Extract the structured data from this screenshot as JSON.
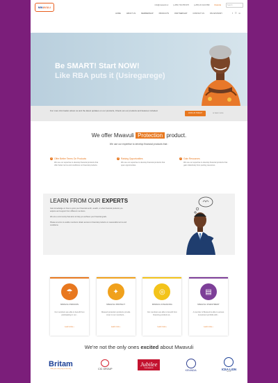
{
  "brand": {
    "logo_text_a": "MW",
    "logo_text_b": "AVULI"
  },
  "topbar": {
    "email": "info@mwavuli.rw",
    "phone1": "(+250) 791 059 976",
    "phone2": "(+250) 22 1124 899",
    "link": "Rwanda",
    "search_placeholder": "Search"
  },
  "nav": {
    "items": [
      "Home",
      "About Us",
      "Membership",
      "Products",
      "Partnership",
      "Contact Us",
      "Fin Advisory"
    ],
    "social": [
      "f",
      "☷",
      "in"
    ]
  },
  "hero": {
    "line1": "Be SMART! Start NOW!",
    "line2": "Like RBA puts it (Usiregarege)"
  },
  "cta": {
    "text": "For more information about us and the latest updates on our products, Check out our products and features included.",
    "button": "JOIN US TODAY!",
    "link": "or learn more"
  },
  "offer": {
    "before": "We offer Mwavuli",
    "highlight": "Protection",
    "after": "product.",
    "sub": "We use our expertise to develop financial products that :",
    "features": [
      {
        "num": "1",
        "title": "Offer Better Terms On Products",
        "desc": "We use our expertise to develop financial products that offer better terms and conditions on financial products."
      },
      {
        "num": "2",
        "title": "Raising Opportunities",
        "desc": "We use our expertise to develop financial products that open opportunities."
      },
      {
        "num": "3",
        "title": "Gain Resources",
        "desc": "We use our expertise to develop financial products that gain collectively from pooling resources."
      }
    ]
  },
  "learn": {
    "title_a": "LEARN FROM OUR",
    "title_b": "EXPERTS",
    "p1": "Gain knowledge on how to grow your financial worth, wealth, or what financial products you acquire and support from different members.",
    "p2": "We are a community that aims to help you achieve your financial goals.",
    "p3": "Please at arms to enable members obtain access to financial products on reasonable terms and conditions."
  },
  "cards": [
    {
      "label": "MWAVULI PENSION",
      "desc": "Our members are able to benefit from participating in our...",
      "more": "Learn more ›",
      "color": "#e8781f",
      "icon": "umbrella-icon",
      "glyph": "☂"
    },
    {
      "label": "MWAVULI PROTECT",
      "desc": "Mwavuli protection products provide cover to our members...",
      "more": "Learn more ›",
      "color": "#f0a11c",
      "icon": "shield-icon",
      "glyph": "✦"
    },
    {
      "label": "MWAVULI FINANCING",
      "desc": "Our members are able to benefit from financing products at...",
      "more": "Learn more ›",
      "color": "#f3c31a",
      "icon": "coins-icon",
      "glyph": "◎"
    },
    {
      "label": "MWAVULI INVESTMENT",
      "desc": "A member of Mwavuli is able to access investment portfolio with...",
      "more": "Learn more ›",
      "color": "#7d3f98",
      "icon": "chart-icon",
      "glyph": "▤"
    }
  ],
  "excited": {
    "before": "We're not the only ones",
    "bold": "excited",
    "after": "about Mwavuli"
  },
  "partners": {
    "britam": "Britam",
    "britam_tag": "With you every step of the way",
    "cic": "CIC GROUP",
    "jubilee": "Jubilee",
    "jubilee_tag": "INSURANCE",
    "kenindia": "KENINDIA",
    "icealion": "ICEA LION",
    "icealion_tag": "GROUP"
  }
}
